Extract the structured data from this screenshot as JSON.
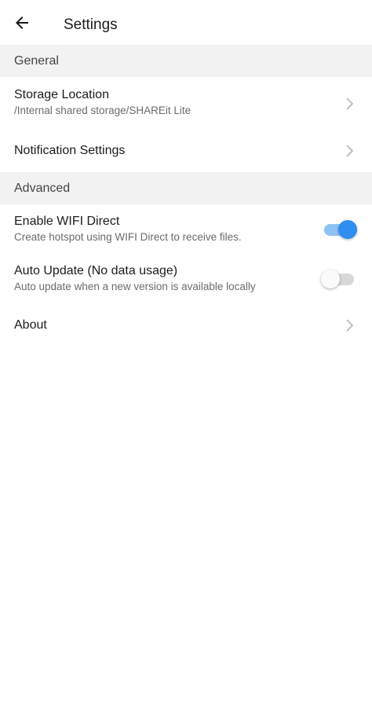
{
  "header": {
    "title": "Settings",
    "back_icon": "arrow-left-icon"
  },
  "sections": {
    "general": {
      "label": "General",
      "storage_location": {
        "title": "Storage Location",
        "subtitle": "/Internal shared storage/SHAREit Lite"
      },
      "notification_settings": {
        "title": "Notification Settings"
      }
    },
    "advanced": {
      "label": "Advanced",
      "wifi_direct": {
        "title": "Enable WIFI Direct",
        "subtitle": "Create hotspot using WIFI Direct to receive files.",
        "enabled": true
      },
      "auto_update": {
        "title": "Auto Update (No data usage)",
        "subtitle": "Auto update when a new version is available locally",
        "enabled": false
      },
      "about": {
        "title": "About"
      }
    }
  },
  "colors": {
    "accent": "#2f8ef0",
    "accent_track": "#8ec2f5",
    "section_bg": "#f2f2f2"
  }
}
